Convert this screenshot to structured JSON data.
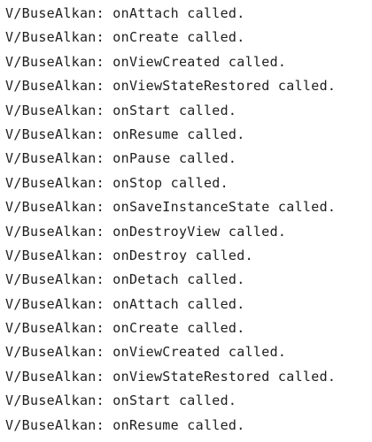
{
  "logcat": {
    "lines": [
      "V/BuseAlkan: onAttach called.",
      "V/BuseAlkan: onCreate called.",
      "V/BuseAlkan: onViewCreated called.",
      "V/BuseAlkan: onViewStateRestored called.",
      "V/BuseAlkan: onStart called.",
      "V/BuseAlkan: onResume called.",
      "V/BuseAlkan: onPause called.",
      "V/BuseAlkan: onStop called.",
      "V/BuseAlkan: onSaveInstanceState called.",
      "V/BuseAlkan: onDestroyView called.",
      "V/BuseAlkan: onDestroy called.",
      "V/BuseAlkan: onDetach called.",
      "V/BuseAlkan: onAttach called.",
      "V/BuseAlkan: onCreate called.",
      "V/BuseAlkan: onViewCreated called.",
      "V/BuseAlkan: onViewStateRestored called.",
      "V/BuseAlkan: onStart called.",
      "V/BuseAlkan: onResume called."
    ]
  }
}
